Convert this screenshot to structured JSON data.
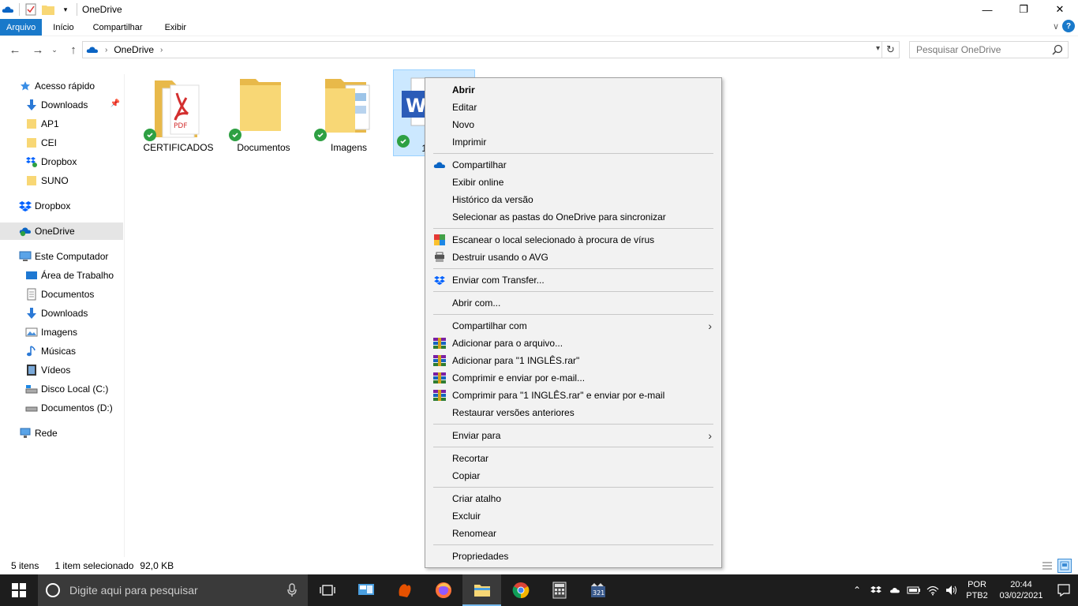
{
  "window": {
    "title": "OneDrive",
    "controls": {
      "minimize": "—",
      "maximize": "❐",
      "close": "✕"
    }
  },
  "ribbon": {
    "tabs": [
      "Arquivo",
      "Início",
      "Compartilhar",
      "Exibir"
    ],
    "expand_glyph": "∨",
    "help_glyph": "?"
  },
  "address_bar": {
    "breadcrumb": "OneDrive",
    "search_placeholder": "Pesquisar OneDrive"
  },
  "sidebar": {
    "items": [
      {
        "label": "Acesso rápido",
        "icon": "star-icon"
      },
      {
        "label": "Downloads",
        "icon": "download-arrow-icon",
        "pinned": true
      },
      {
        "label": "AP1",
        "icon": "folder-icon"
      },
      {
        "label": "CEI",
        "icon": "folder-icon"
      },
      {
        "label": "Dropbox",
        "icon": "dropbox-folder-icon"
      },
      {
        "label": "SUNO",
        "icon": "folder-icon"
      },
      {
        "label": "Dropbox",
        "icon": "dropbox-icon"
      },
      {
        "label": "OneDrive",
        "icon": "onedrive-icon",
        "selected": true
      },
      {
        "label": "Este Computador",
        "icon": "computer-icon"
      },
      {
        "label": "Área de Trabalho",
        "icon": "desktop-icon"
      },
      {
        "label": "Documentos",
        "icon": "documents-icon"
      },
      {
        "label": "Downloads",
        "icon": "download-arrow-icon"
      },
      {
        "label": "Imagens",
        "icon": "pictures-icon"
      },
      {
        "label": "Músicas",
        "icon": "music-icon"
      },
      {
        "label": "Vídeos",
        "icon": "videos-icon"
      },
      {
        "label": "Disco Local (C:)",
        "icon": "drive-c-icon"
      },
      {
        "label": "Documentos (D:)",
        "icon": "drive-d-icon"
      },
      {
        "label": "Rede",
        "icon": "network-icon"
      }
    ]
  },
  "files": [
    {
      "name": "CERTIFICADOS",
      "icon": "folder-pdf-icon",
      "synced": true
    },
    {
      "name": "Documentos",
      "icon": "folder-icon",
      "synced": true
    },
    {
      "name": "Imagens",
      "icon": "folder-images-icon",
      "synced": true
    },
    {
      "name": "1 I",
      "icon": "word-document-icon",
      "synced": true,
      "selected": true
    }
  ],
  "status": {
    "count": "5 itens",
    "selection": "1 item selecionado",
    "size": "92,0 KB"
  },
  "context_menu": {
    "items": [
      {
        "label": "Abrir",
        "bold": true
      },
      {
        "label": "Editar"
      },
      {
        "label": "Novo"
      },
      {
        "label": "Imprimir"
      },
      {
        "sep": true
      },
      {
        "label": "Compartilhar",
        "icon": "onedrive-cloud-icon"
      },
      {
        "label": "Exibir online"
      },
      {
        "label": "Histórico da versão"
      },
      {
        "label": "Selecionar as pastas do OneDrive para sincronizar"
      },
      {
        "sep": true
      },
      {
        "label": "Escanear o local selecionado à procura de vírus",
        "icon": "avg-icon"
      },
      {
        "label": "Destruir usando o AVG",
        "icon": "shredder-icon"
      },
      {
        "sep": true
      },
      {
        "label": "Enviar com Transfer...",
        "icon": "dropbox-icon"
      },
      {
        "sep": true
      },
      {
        "label": "Abrir com..."
      },
      {
        "sep": true
      },
      {
        "label": "Compartilhar com",
        "submenu": true
      },
      {
        "label": "Adicionar para o arquivo...",
        "icon": "winrar-icon"
      },
      {
        "label": "Adicionar para \"1 INGLÊS.rar\"",
        "icon": "winrar-icon"
      },
      {
        "label": "Comprimir e enviar por e-mail...",
        "icon": "winrar-icon"
      },
      {
        "label": "Comprimir para \"1 INGLÊS.rar\" e enviar por e-mail",
        "icon": "winrar-icon"
      },
      {
        "label": "Restaurar versões anteriores"
      },
      {
        "sep": true
      },
      {
        "label": "Enviar para",
        "submenu": true
      },
      {
        "sep": true
      },
      {
        "label": "Recortar"
      },
      {
        "label": "Copiar"
      },
      {
        "sep": true
      },
      {
        "label": "Criar atalho"
      },
      {
        "label": "Excluir"
      },
      {
        "label": "Renomear"
      },
      {
        "sep": true
      },
      {
        "label": "Propriedades"
      }
    ]
  },
  "taskbar": {
    "search_placeholder": "Digite aqui para pesquisar",
    "language_top": "POR",
    "language_bottom": "PTB2",
    "time": "20:44",
    "date": "03/02/2021"
  },
  "colors": {
    "accent": "#1979ca",
    "selection": "#cce8ff",
    "sync_check": "#2ea043",
    "folder": "#f8d775",
    "taskbar": "#1d1d1d"
  }
}
